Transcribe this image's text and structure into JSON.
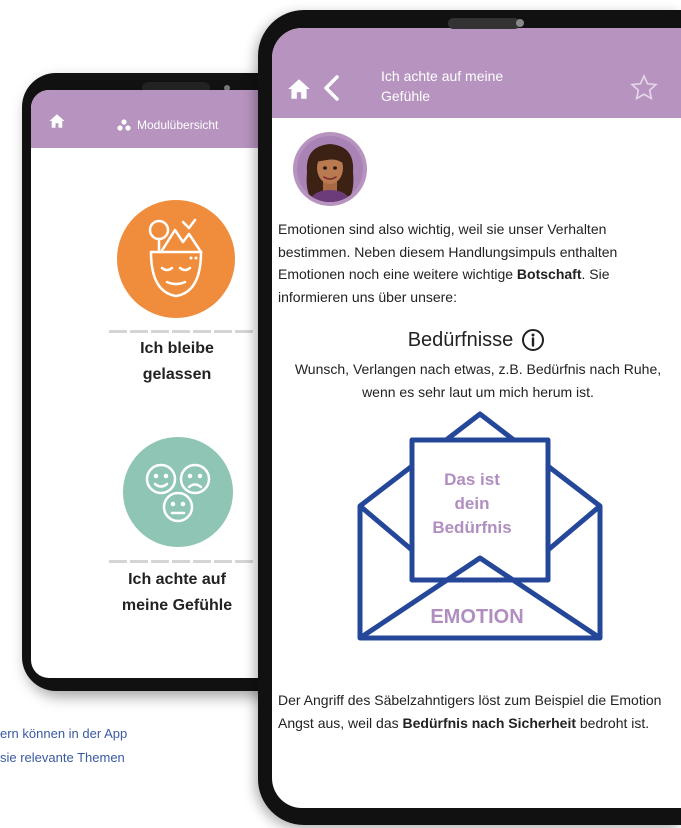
{
  "caption": {
    "line1": "ern können in der App",
    "line2": "sie relevante Themen"
  },
  "back_phone": {
    "header_title": "Modulübersicht",
    "modules": [
      {
        "label_line1": "Ich bleibe",
        "label_line2": "gelassen",
        "icon": "calm-head-icon"
      },
      {
        "label_line1": "Ich achte auf",
        "label_line2": "meine Gefühle",
        "icon": "faces-icon"
      }
    ]
  },
  "front_phone": {
    "header_title_line1": "Ich achte auf meine",
    "header_title_line2": "Gefühle",
    "paragraph1": {
      "part1": "Emotionen sind also wichtig, weil sie unser Verhalten bestimmen. Neben diesem Handlungsimpuls enthalten Emotionen noch eine weitere wichtige ",
      "bold": "Botschaft",
      "part2": ". Sie informieren uns über unsere:"
    },
    "needs_title": "Bedürfnisse",
    "needs_desc": "Wunsch, Verlangen nach etwas, z.B. Bedürfnis nach Ruhe, wenn es sehr laut um mich herum ist.",
    "envelope": {
      "letter_line1": "Das ist",
      "letter_line2": "dein",
      "letter_line3": "Bedürfnis",
      "label": "EMOTION"
    },
    "paragraph2": {
      "part1": "Der Angriff des Säbelzahntigers löst zum Beispiel die Emotion Angst aus, weil das ",
      "bold": "Bedürfnis nach Sicherheit",
      "part2": " bedroht ist."
    }
  },
  "colors": {
    "header": "#b694bf",
    "orange": "#f08d3c",
    "mint": "#8fc5b5",
    "envelope_stroke": "#25479a",
    "accent_text": "#b08ec0",
    "caption": "#3a5aa0"
  }
}
